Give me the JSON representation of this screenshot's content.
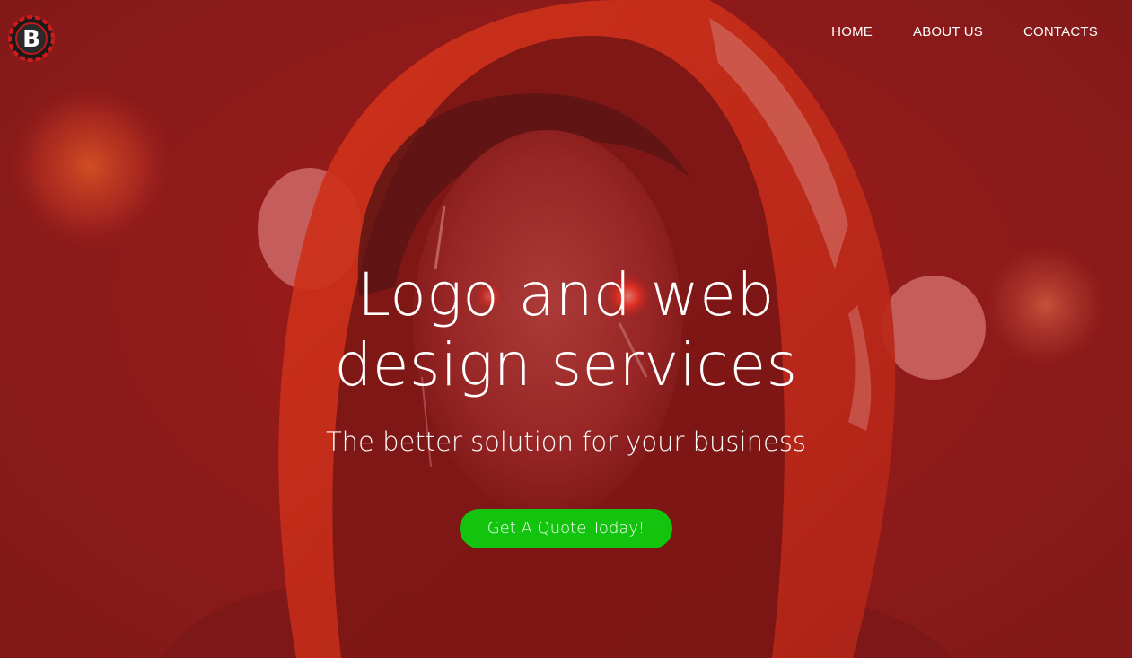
{
  "brand": {
    "logo_icon": "b-letter-logo-icon",
    "logo_letter": "B"
  },
  "nav": {
    "items": [
      {
        "label": "HOME"
      },
      {
        "label": "ABOUT US"
      },
      {
        "label": "CONTACTS"
      }
    ]
  },
  "hero": {
    "title_line1": "Logo and web",
    "title_line2": "design services",
    "subtitle": "The better solution for your business",
    "cta_label": "Get A Quote Today!",
    "background_image": "hooded-figure-red-image"
  },
  "colors": {
    "background": "#8e1c1c",
    "cta": "#12c40e",
    "text": "#ffffff"
  }
}
